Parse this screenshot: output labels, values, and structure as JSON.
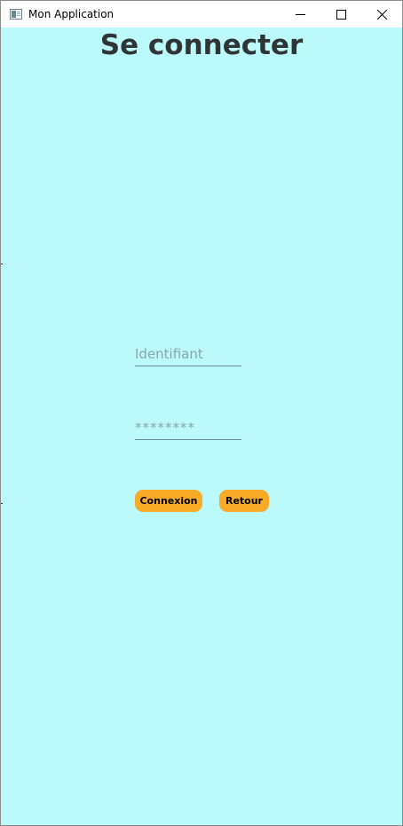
{
  "window": {
    "title": "Mon Application",
    "controls": {
      "minimize_icon": "minimize-icon",
      "maximize_icon": "maximize-icon",
      "close_icon": "close-icon"
    }
  },
  "page": {
    "title": "Se connecter"
  },
  "form": {
    "username_placeholder": "Identifiant",
    "username_value": "",
    "password_placeholder": "********",
    "password_value": ""
  },
  "buttons": {
    "login_label": "Connexion",
    "back_label": "Retour"
  },
  "colors": {
    "background": "#bcf9fb",
    "title_text": "#2f3436",
    "button_fill": "#f9ab27",
    "field_underline": "#6d8a93"
  }
}
